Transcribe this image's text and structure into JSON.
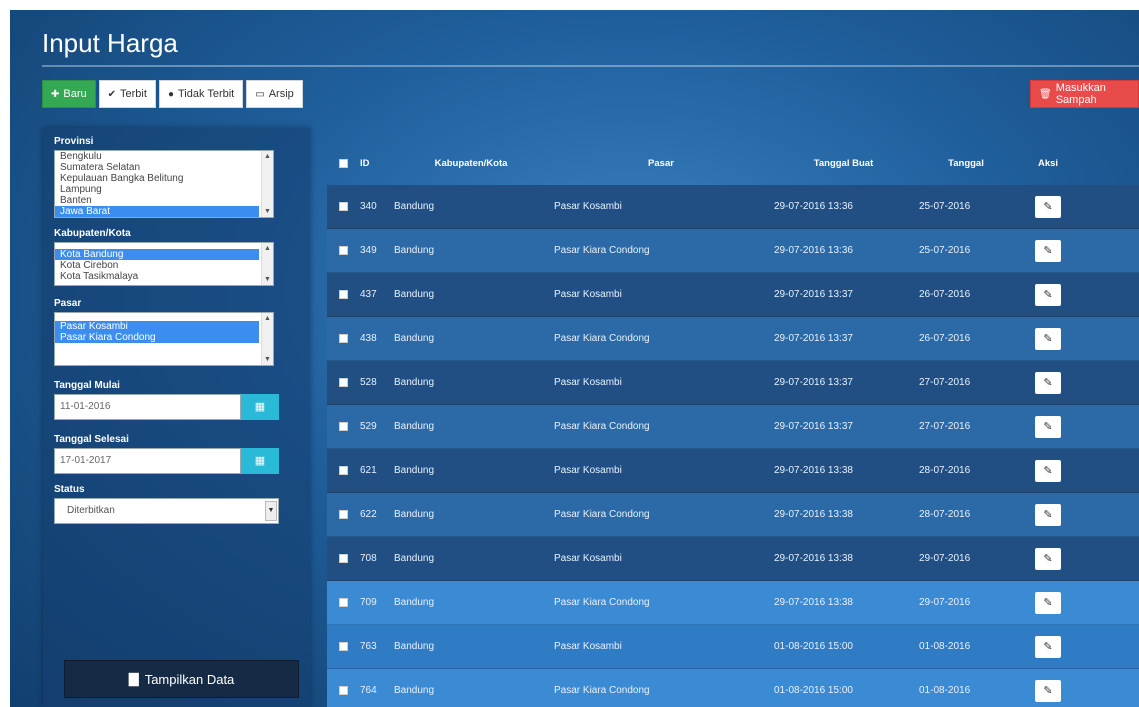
{
  "title": "Input Harga",
  "toolbar": {
    "baru": "Baru",
    "terbit": "Terbit",
    "tidak_terbit": "Tidak Terbit",
    "arsip": "Arsip",
    "masukkan_sampah": "Masukkan Sampah"
  },
  "sidebar": {
    "provinsi_label": "Provinsi",
    "provinsi_options": [
      "Bengkulu",
      "Sumatera Selatan",
      "Kepulauan Bangka Belitung",
      "Lampung",
      "Banten",
      "Jawa Barat"
    ],
    "provinsi_selected": "Jawa Barat",
    "kota_label": "Kabupaten/Kota",
    "kota_options": [
      "Kota Bandung",
      "Kota Cirebon",
      "Kota Tasikmalaya"
    ],
    "kota_selected": "Kota Bandung",
    "pasar_label": "Pasar",
    "pasar_options": [
      "Pasar Kosambi",
      "Pasar Kiara Condong"
    ],
    "tanggal_mulai_label": "Tanggal Mulai",
    "tanggal_mulai": "11-01-2016",
    "tanggal_selesai_label": "Tanggal Selesai",
    "tanggal_selesai": "17-01-2017",
    "status_label": "Status",
    "status_value": "Diterbitkan",
    "tampilkan_label": "Tampilkan Data"
  },
  "table": {
    "headers": {
      "id": "ID",
      "kota": "Kabupaten/Kota",
      "pasar": "Pasar",
      "buat": "Tanggal Buat",
      "tanggal": "Tanggal",
      "aksi": "Aksi"
    },
    "rows": [
      {
        "id": "340",
        "kota": "Bandung",
        "pasar": "Pasar Kosambi",
        "buat": "29-07-2016 13:36",
        "tanggal": "25-07-2016"
      },
      {
        "id": "349",
        "kota": "Bandung",
        "pasar": "Pasar Kiara Condong",
        "buat": "29-07-2016 13:36",
        "tanggal": "25-07-2016"
      },
      {
        "id": "437",
        "kota": "Bandung",
        "pasar": "Pasar Kosambi",
        "buat": "29-07-2016 13:37",
        "tanggal": "26-07-2016"
      },
      {
        "id": "438",
        "kota": "Bandung",
        "pasar": "Pasar Kiara Condong",
        "buat": "29-07-2016 13:37",
        "tanggal": "26-07-2016"
      },
      {
        "id": "528",
        "kota": "Bandung",
        "pasar": "Pasar Kosambi",
        "buat": "29-07-2016 13:37",
        "tanggal": "27-07-2016"
      },
      {
        "id": "529",
        "kota": "Bandung",
        "pasar": "Pasar Kiara Condong",
        "buat": "29-07-2016 13:37",
        "tanggal": "27-07-2016"
      },
      {
        "id": "621",
        "kota": "Bandung",
        "pasar": "Pasar Kosambi",
        "buat": "29-07-2016 13:38",
        "tanggal": "28-07-2016"
      },
      {
        "id": "622",
        "kota": "Bandung",
        "pasar": "Pasar Kiara Condong",
        "buat": "29-07-2016 13:38",
        "tanggal": "28-07-2016"
      },
      {
        "id": "708",
        "kota": "Bandung",
        "pasar": "Pasar Kosambi",
        "buat": "29-07-2016 13:38",
        "tanggal": "29-07-2016"
      },
      {
        "id": "709",
        "kota": "Bandung",
        "pasar": "Pasar Kiara Condong",
        "buat": "29-07-2016 13:38",
        "tanggal": "29-07-2016"
      },
      {
        "id": "763",
        "kota": "Bandung",
        "pasar": "Pasar Kosambi",
        "buat": "01-08-2016 15:00",
        "tanggal": "01-08-2016"
      },
      {
        "id": "764",
        "kota": "Bandung",
        "pasar": "Pasar Kiara Condong",
        "buat": "01-08-2016 15:00",
        "tanggal": "01-08-2016"
      }
    ]
  },
  "colors": {
    "green": "#35a853",
    "red": "#e94b4b",
    "cyan": "#2ab9d6",
    "selected": "#3b8ef0"
  }
}
